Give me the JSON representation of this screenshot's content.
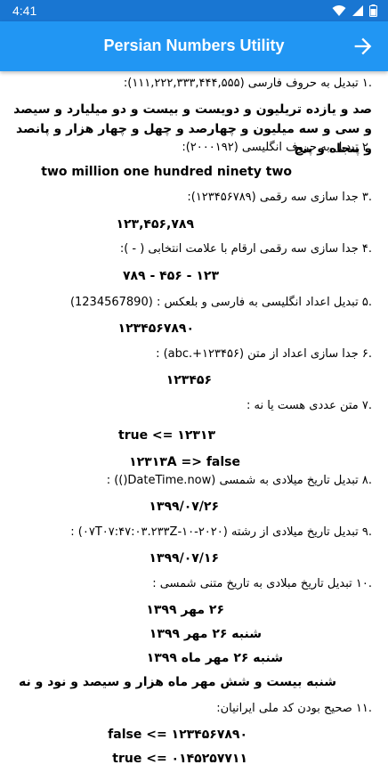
{
  "status_bar": {
    "time": "4:41"
  },
  "app_bar": {
    "title": "Persian Numbers Utility"
  },
  "items": [
    {
      "heading": ".۱ تبدیل به حروف فارسی (۱۱۱,۲۲۲,۳۳۳,۴۴۴,۵۵۵):",
      "results": [
        "صد و یازده تریلیون و دویست و بیست و دو میلیارد و سیصد و سی و سه میلیون و چهارصد و چهل و چهار هزار و پانصد و پنجاه و پنج"
      ]
    },
    {
      "heading": ".۲ تبدیل به حروف انگلیسی (۲۰۰۰۱۹۲):",
      "results": [
        "two million  one hundred ninety two"
      ]
    },
    {
      "heading": ".۳ جدا سازی سه رقمی (۱۲۳۴۵۶۷۸۹):",
      "results": [
        "۱۲۳,۴۵۶,۷۸۹"
      ]
    },
    {
      "heading": ".۴ جدا سازی سه رقمی ارقام با علامت انتخابی ( - ):",
      "results": [
        "۱۲۳ - ۴۵۶ - ۷۸۹"
      ]
    },
    {
      "heading": ".۵ تبدیل اعداد انگلیسی به فارسی و بلعکس : (1234567890)",
      "results": [
        "۱۲۳۴۵۶۷۸۹۰"
      ]
    },
    {
      "heading": ".۶ جدا سازی اعداد از متن (abc.+۱۲۳۴۵۶) :",
      "results": [
        "۱۲۳۴۵۶"
      ]
    },
    {
      "heading": ".۷ متن عددی هست یا نه :",
      "results": [
        "true <= ۱۲۳۱۳",
        "۱۲۳۱۳A => false"
      ]
    },
    {
      "heading": ".۸ تبدیل تاریخ میلادی به شمسی (DateTime.now()) :",
      "results": [
        "۱۳۹۹/۰۷/۲۶"
      ]
    },
    {
      "heading": ".۹ تبدیل تاریخ میلادی از رشته (۲۰۲۰-۱۰-۰۷T۰۷:۴۷:۰۳.۲۳۳Z) :",
      "results": [
        "۱۳۹۹/۰۷/۱۶"
      ]
    },
    {
      "heading": ".۱۰ تبدیل تاریخ مبلادی به تاریخ متنی شمسی :",
      "results": [
        "۲۶ مهر  ۱۳۹۹",
        "شنبه ۲۶ مهر  ۱۳۹۹",
        "شنبه ۲۶ مهر ماه  ۱۳۹۹",
        "شنبه بیست و شش مهر ماه  هزار و سیصد و نود و نه"
      ]
    },
    {
      "heading": ".۱۱ صحیح بودن کد ملی ایرانیان:",
      "results": [
        "false <= ۱۲۳۴۵۶۷۸۹۰",
        "true <= ۰۱۴۵۲۵۷۷۱۱"
      ]
    }
  ]
}
